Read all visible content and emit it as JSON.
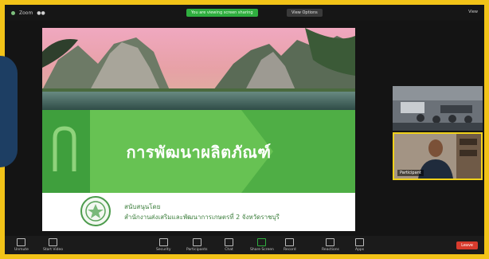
{
  "topbar": {
    "meeting_info": "Zoom",
    "share_banner": "You are viewing screen sharing",
    "stop_label": "View Options",
    "view_label": "View"
  },
  "slide": {
    "title": "การพัฒนาผลิตภัณฑ์",
    "supported_by": "สนับสนุนโดย",
    "office": "สำนักงานส่งเสริมและพัฒนาการเกษตรที่ 2 จังหวัดราชบุรี"
  },
  "participants": {
    "thumb2_label": "Participant"
  },
  "toolbar": {
    "items": [
      {
        "label": "Unmute"
      },
      {
        "label": "Start Video"
      },
      {
        "label": "Security"
      },
      {
        "label": "Participants"
      },
      {
        "label": "Chat"
      },
      {
        "label": "Share Screen"
      },
      {
        "label": "Record"
      },
      {
        "label": "Reactions"
      },
      {
        "label": "Apps"
      }
    ],
    "leave_label": "Leave"
  },
  "colors": {
    "frame_border": "#f2c318",
    "slide_green": "#67c253",
    "banner_green": "#2fae3f",
    "leave_red": "#d83b2d"
  }
}
